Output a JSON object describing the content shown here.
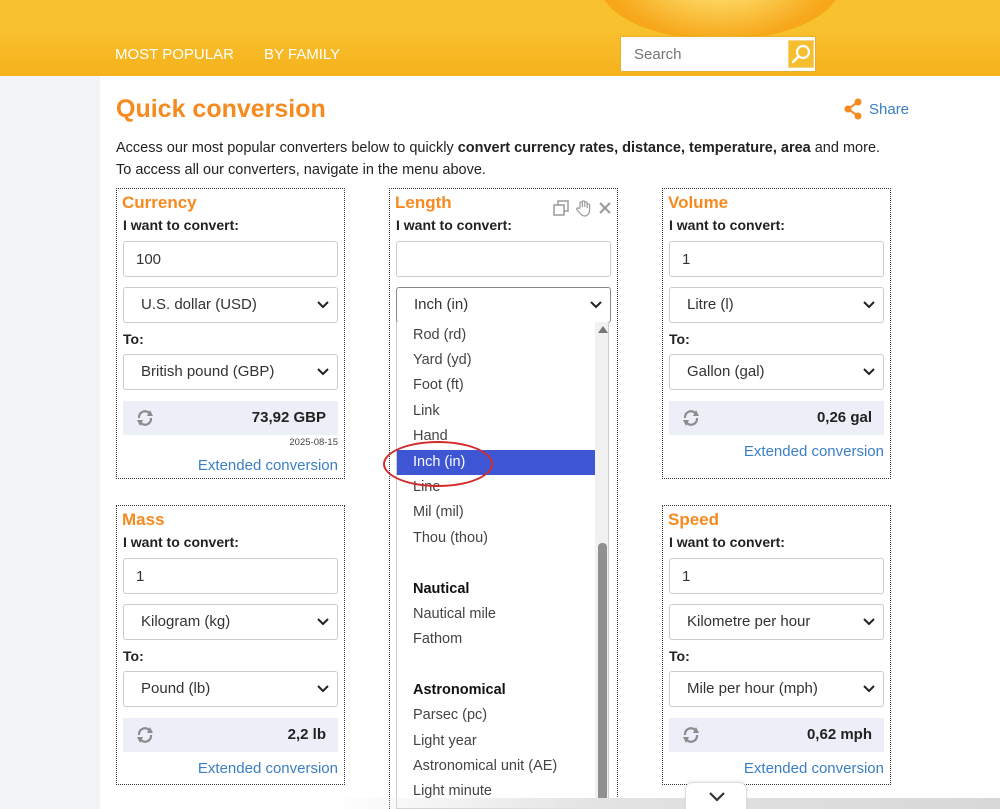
{
  "nav": {
    "most_popular": "MOST POPULAR",
    "by_family": "BY FAMILY",
    "search_placeholder": "Search"
  },
  "page": {
    "title": "Quick conversion",
    "share": "Share",
    "intro_prefix": "Access our most popular converters below to quickly ",
    "intro_bold": "convert currency rates, distance, temperature, area",
    "intro_suffix": " and more.",
    "intro_line2": "To access all our converters, navigate in the menu above."
  },
  "labels": {
    "i_want": "I want to convert:",
    "to": "To:",
    "extended": "Extended conversion"
  },
  "cards": {
    "currency": {
      "title": "Currency",
      "value": "100",
      "from": "U.S. dollar (USD)",
      "to": "British pound (GBP)",
      "result": "73,92 GBP",
      "date": "2025-08-15"
    },
    "length": {
      "title": "Length",
      "value": "",
      "from": "Inch (in)"
    },
    "volume": {
      "title": "Volume",
      "value": "1",
      "from": "Litre (l)",
      "to": "Gallon (gal)",
      "result": "0,26 gal"
    },
    "mass": {
      "title": "Mass",
      "value": "1",
      "from": "Kilogram (kg)",
      "to": "Pound (lb)",
      "result": "2,2 lb"
    },
    "speed": {
      "title": "Speed",
      "value": "1",
      "from": "Kilometre per hour",
      "to": "Mile per hour (mph)",
      "result": "0,62 mph"
    }
  },
  "dropdown": {
    "options": [
      "Rod (rd)",
      "Yard (yd)",
      "Foot (ft)",
      "Link",
      "Hand",
      "Inch (in)",
      "Line",
      "Mil (mil)",
      "Thou (thou)",
      "Nautical",
      "Nautical mile",
      "Fathom",
      "Astronomical",
      "Parsec (pc)",
      "Light year",
      "Astronomical unit (AE)",
      "Light minute"
    ],
    "selected": "Inch (in)"
  },
  "colors": {
    "accent_orange": "#f58a1f",
    "link_blue": "#3a7fc4",
    "selected_blue": "#3e56d4",
    "highlight_red": "#d22b2b",
    "topbar_yellow": "#f8c22f"
  }
}
